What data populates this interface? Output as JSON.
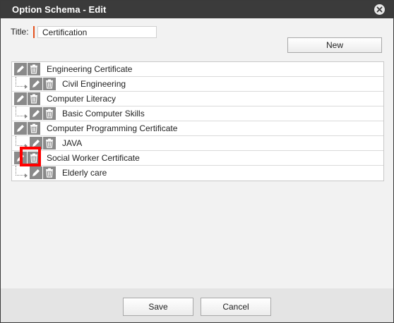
{
  "dialog": {
    "title": "Option Schema - Edit"
  },
  "form": {
    "title_label": "Title:",
    "title_value": "Certification"
  },
  "toolbar": {
    "new_label": "New"
  },
  "tree": {
    "items": [
      {
        "label": "Engineering Certificate",
        "level": 0
      },
      {
        "label": "Civil Engineering",
        "level": 1
      },
      {
        "label": "Computer Literacy",
        "level": 0
      },
      {
        "label": "Basic Computer Skills",
        "level": 1
      },
      {
        "label": "Computer Programming Certificate",
        "level": 0
      },
      {
        "label": "JAVA",
        "level": 1
      },
      {
        "label": "Social Worker Certificate",
        "level": 0
      },
      {
        "label": "Elderly care",
        "level": 1
      }
    ],
    "icons": {
      "edit": "pencil-icon",
      "delete": "trash-icon"
    }
  },
  "footer": {
    "save_label": "Save",
    "cancel_label": "Cancel"
  },
  "colors": {
    "titlebar": "#3b3b3b",
    "required_marker": "#e4521f",
    "icon_button": "#8a8a8a",
    "highlight": "#ff0000"
  }
}
